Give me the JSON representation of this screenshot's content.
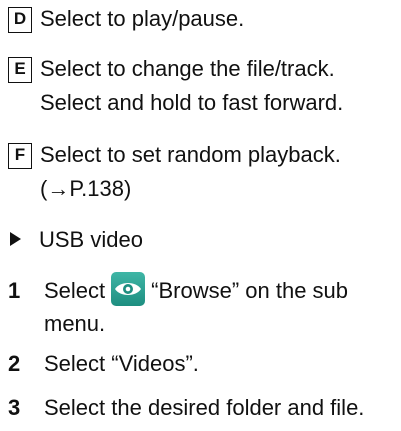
{
  "items": {
    "d": {
      "key": "D",
      "text": "Select to play/pause."
    },
    "e": {
      "key": "E",
      "text1": "Select to change the file/track.",
      "text2": "Select and hold to fast forward."
    },
    "f": {
      "key": "F",
      "text1": "Select to set random playback.",
      "text2": "(→P.138)"
    }
  },
  "section": {
    "title": "USB video"
  },
  "steps": {
    "s1": {
      "num": "1",
      "pre": "Select",
      "post": "“Browse” on the sub",
      "cont": "menu.",
      "icon": "browse-eye-icon"
    },
    "s2": {
      "num": "2",
      "text": "Select “Videos”."
    },
    "s3": {
      "num": "3",
      "text": "Select the desired folder and file."
    }
  }
}
